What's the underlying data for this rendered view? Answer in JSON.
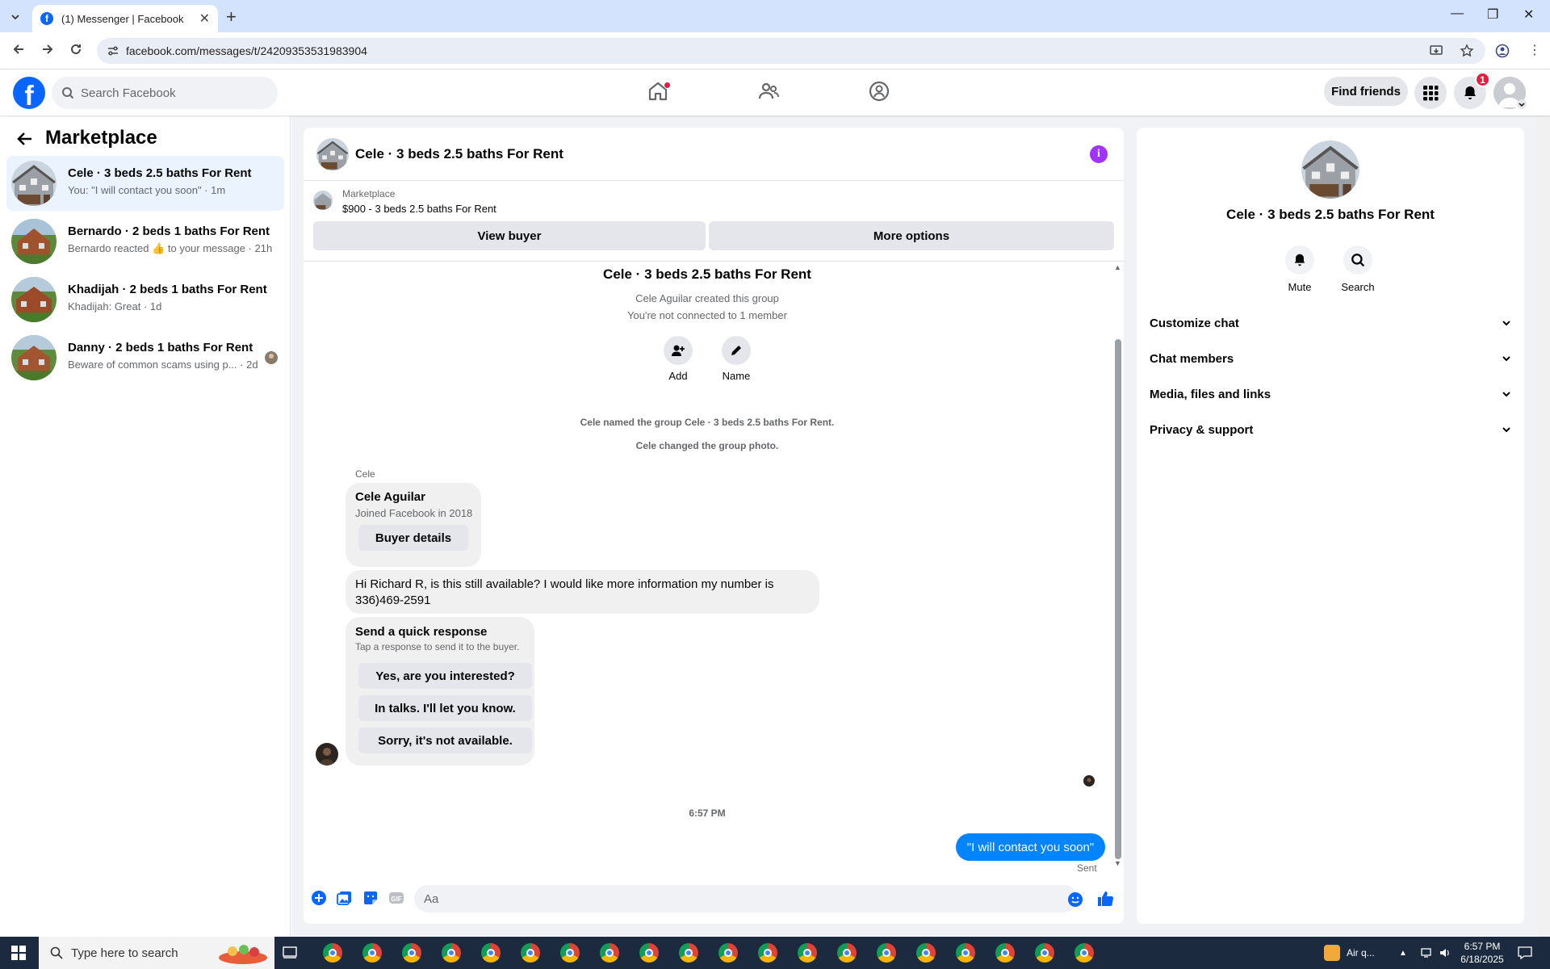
{
  "browser": {
    "tab_title": "(1) Messenger | Facebook",
    "url": "facebook.com/messages/t/24209353531983904"
  },
  "header": {
    "search_placeholder": "Search Facebook",
    "find_friends": "Find friends",
    "notification_count": "1"
  },
  "sidebar": {
    "title": "Marketplace",
    "conversations": [
      {
        "title": "Cele · 3 beds 2.5 baths For Rent",
        "subtitle": "You: \"I will contact you soon\" · 1m",
        "active": true
      },
      {
        "title": "Bernardo · 2 beds 1 baths For Rent",
        "subtitle": "Bernardo reacted 👍 to your message · 21h"
      },
      {
        "title": "Khadijah · 2 beds 1 baths For Rent",
        "subtitle": "Khadijah: Great · 1d"
      },
      {
        "title": "Danny · 2 beds 1 baths For Rent",
        "subtitle": "Beware of common scams using p... · 2d"
      }
    ]
  },
  "chat": {
    "title": "Cele · 3 beds 2.5 baths For Rent",
    "marketplace_label": "Marketplace",
    "listing": "$900 - 3 beds 2.5 baths For Rent",
    "view_buyer": "View buyer",
    "more_options": "More options",
    "group_title": "Cele · 3 beds 2.5 baths For Rent",
    "created_by": "Cele Aguilar created this group",
    "not_connected": "You're not connected to 1 member",
    "add_label": "Add",
    "name_label": "Name",
    "event_named": "Cele named the group Cele · 3 beds 2.5 baths For Rent.",
    "event_photo": "Cele changed the group photo.",
    "sender_name": "Cele",
    "profile_name": "Cele Aguilar",
    "profile_joined": "Joined Facebook in 2018",
    "buyer_details": "Buyer details",
    "message_line1": "Hi Richard R, is this still available? I would like more information my number is",
    "message_line2": "336)469-2591",
    "quick_title": "Send a quick response",
    "quick_sub": "Tap a response to send it to the buyer.",
    "quick_responses": [
      "Yes, are you interested?",
      "In talks. I'll let you know.",
      "Sorry, it's not available."
    ],
    "timestamp": "6:57 PM",
    "sent_message": "\"I will contact you soon\"",
    "sent_status": "Sent",
    "composer_placeholder": "Aa"
  },
  "details": {
    "title": "Cele · 3 beds 2.5 baths For Rent",
    "mute": "Mute",
    "search": "Search",
    "sections": [
      "Customize chat",
      "Chat members",
      "Media, files and links",
      "Privacy & support"
    ]
  },
  "taskbar": {
    "search_placeholder": "Type here to search",
    "weather": "Air q...",
    "time": "6:57 PM",
    "date": "6/18/2025"
  },
  "colors": {
    "fb_blue": "#0866ff",
    "messenger_blue": "#0084ff",
    "accent_purple": "#a033ff",
    "badge_red": "#e41e3f"
  }
}
